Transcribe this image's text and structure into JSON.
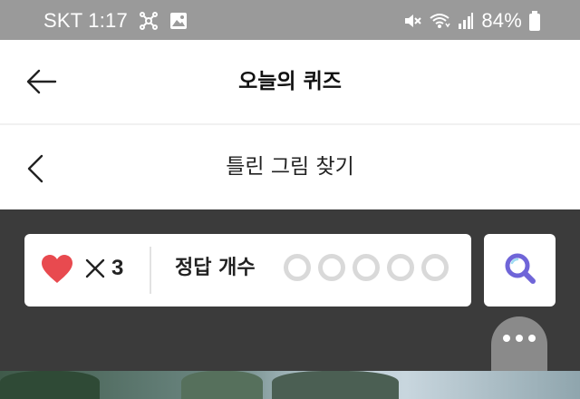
{
  "status_bar": {
    "carrier_time": "SKT 1:17",
    "battery": "84%",
    "icons": [
      "network-share-icon",
      "image-icon",
      "mute-icon",
      "wifi-icon",
      "signal-icon",
      "battery-icon"
    ]
  },
  "app_bar": {
    "back_icon": "back-arrow-icon",
    "title": "오늘의 퀴즈"
  },
  "sub_bar": {
    "prev_icon": "chevron-left-icon",
    "title": "틀린 그림 찾기"
  },
  "quiz_panel": {
    "lives_icon": "heart-icon",
    "times_symbol_icon": "multiply-icon",
    "lives_count": "3",
    "answer_label": "정답 개수",
    "answers_found": 0,
    "answers_total": 5,
    "search_icon": "magnifier-icon",
    "more_icon": "more-dots-icon"
  },
  "colors": {
    "status_bar_bg": "#9a9a9a",
    "game_bg": "#3b3b3b",
    "heart": "#e84a4f",
    "search_accent": "#6f65d8",
    "empty_circle": "#d9d9d9"
  }
}
